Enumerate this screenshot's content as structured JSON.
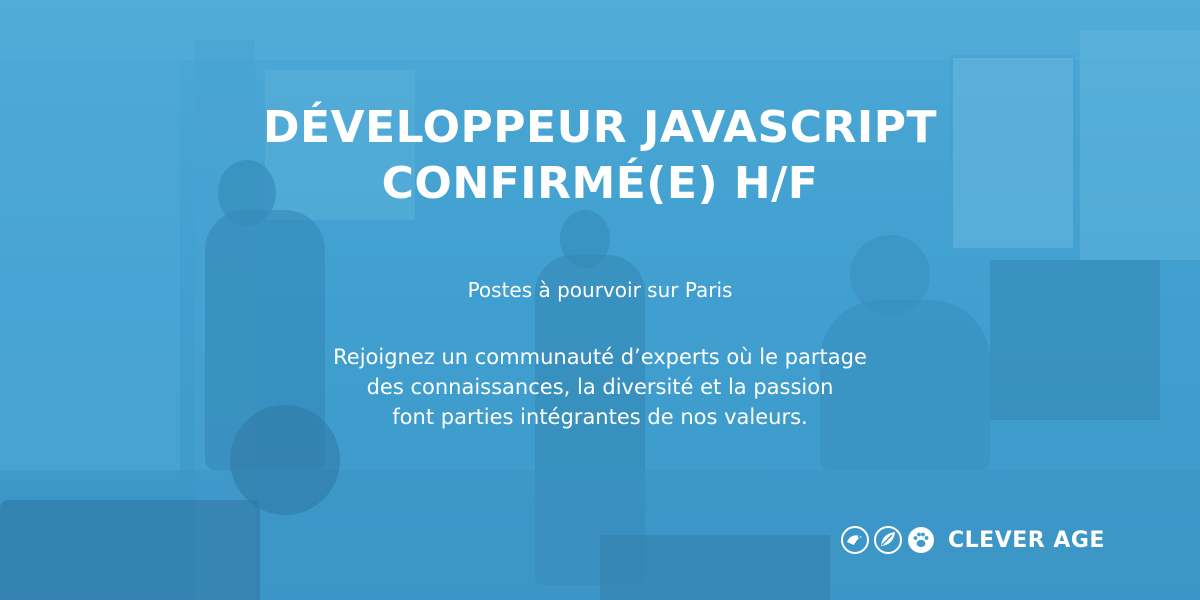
{
  "headline": {
    "line1": "DÉVELOPPEUR JAVASCRIPT",
    "line2": "CONFIRMÉ(E) H/F"
  },
  "subtitle": "Postes à pourvoir sur Paris",
  "description": {
    "line1": "Rejoignez un communauté d’experts où le partage",
    "line2": "des connaissances, la diversité et la passion",
    "line3": "font parties intégrantes de nos valeurs."
  },
  "logo": {
    "text": "CLEVER AGE",
    "icons": [
      "bird-icon",
      "leaf-icon",
      "paw-icon"
    ]
  },
  "colors": {
    "background": "#3e9ccc",
    "text": "#ffffff"
  }
}
